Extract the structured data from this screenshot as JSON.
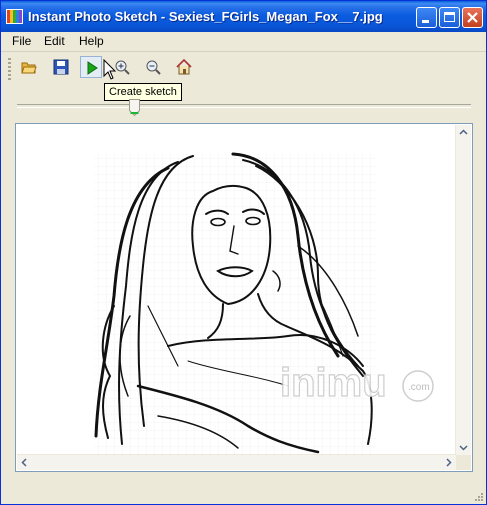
{
  "window": {
    "title": "Instant Photo Sketch - Sexiest_FGirls_Megan_Fox__7.jpg"
  },
  "title_buttons": [
    "minimize-icon",
    "maximize-icon",
    "close-icon"
  ],
  "menu": {
    "items": [
      "File",
      "Edit",
      "Help"
    ]
  },
  "toolbar": {
    "buttons": [
      "open-folder-icon",
      "save-icon",
      "play-icon",
      "zoom-in-icon",
      "zoom-out-icon",
      "home-icon"
    ],
    "tooltip": "Create sketch"
  },
  "slider": {
    "level": 0.26
  },
  "canvas": {
    "watermark": "inimu",
    "watermark_suffix": ".com"
  },
  "colors": {
    "titlebar": "#0a56d8",
    "face": "#ece9d8",
    "tooltip": "#ffffe1"
  }
}
